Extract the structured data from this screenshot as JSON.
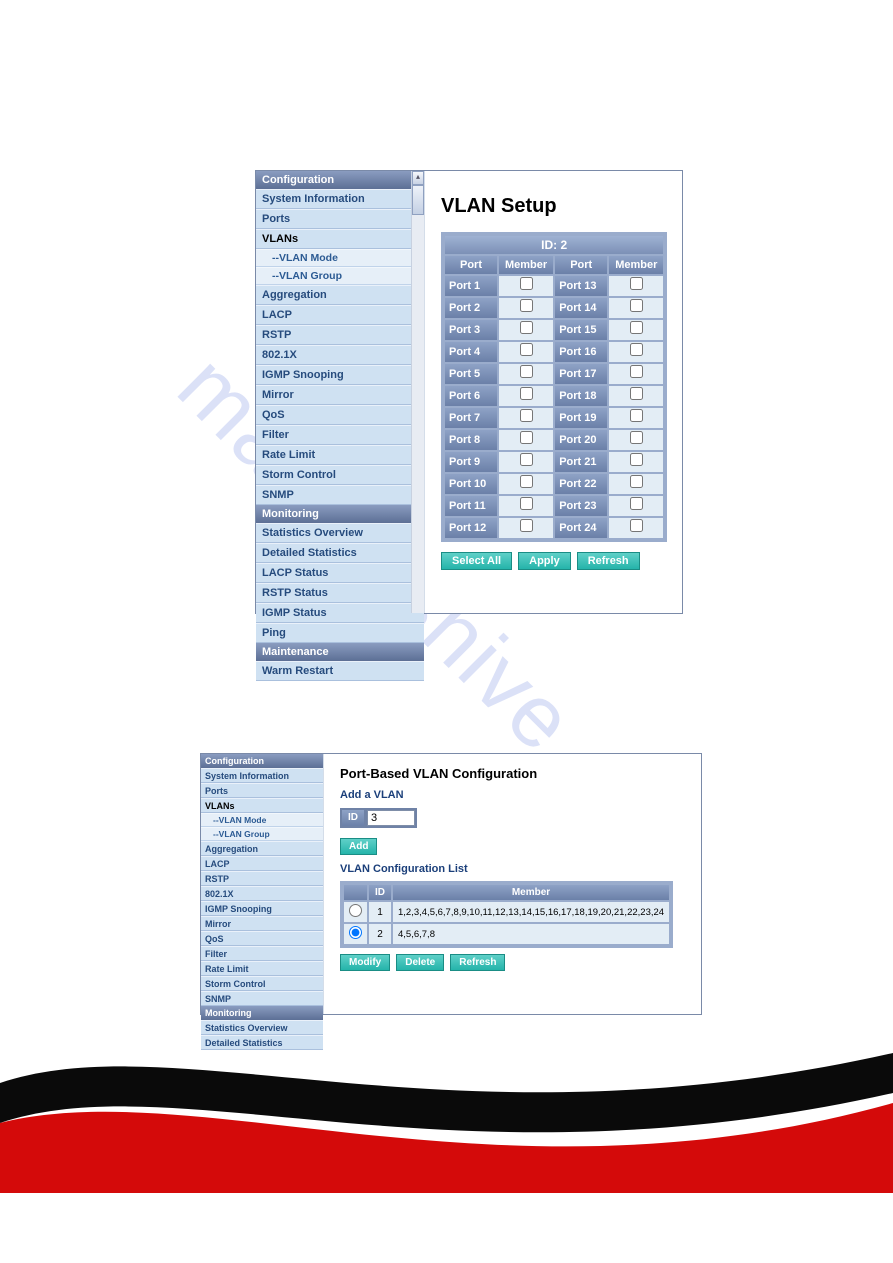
{
  "watermark_text": "manualshive.com",
  "nav1": {
    "section_config": "Configuration",
    "items_config": [
      "System Information",
      "Ports",
      "VLANs"
    ],
    "subitems": [
      "--VLAN Mode",
      "--VLAN Group"
    ],
    "items_config2": [
      "Aggregation",
      "LACP",
      "RSTP",
      "802.1X",
      "IGMP Snooping",
      "Mirror",
      "QoS",
      "Filter",
      "Rate Limit",
      "Storm Control",
      "SNMP"
    ],
    "section_monitoring": "Monitoring",
    "items_monitoring": [
      "Statistics Overview",
      "Detailed Statistics",
      "LACP Status",
      "RSTP Status",
      "IGMP Status",
      "Ping"
    ],
    "section_maintenance": "Maintenance",
    "items_maintenance": [
      "Warm Restart"
    ]
  },
  "vlan_setup": {
    "title": "VLAN Setup",
    "id_label": "ID: 2",
    "col_port": "Port",
    "col_member": "Member",
    "left_ports": [
      "Port 1",
      "Port 2",
      "Port 3",
      "Port 4",
      "Port 5",
      "Port 6",
      "Port 7",
      "Port 8",
      "Port 9",
      "Port 10",
      "Port 11",
      "Port 12"
    ],
    "right_ports": [
      "Port 13",
      "Port 14",
      "Port 15",
      "Port 16",
      "Port 17",
      "Port 18",
      "Port 19",
      "Port 20",
      "Port 21",
      "Port 22",
      "Port 23",
      "Port 24"
    ],
    "btn_select_all": "Select All",
    "btn_apply": "Apply",
    "btn_refresh": "Refresh"
  },
  "nav2": {
    "section_config": "Configuration",
    "items_config": [
      "System Information",
      "Ports",
      "VLANs"
    ],
    "subitems": [
      "--VLAN Mode",
      "--VLAN Group"
    ],
    "items_config2": [
      "Aggregation",
      "LACP",
      "RSTP",
      "802.1X",
      "IGMP Snooping",
      "Mirror",
      "QoS",
      "Filter",
      "Rate Limit",
      "Storm Control",
      "SNMP"
    ],
    "section_monitoring": "Monitoring",
    "items_monitoring": [
      "Statistics Overview",
      "Detailed Statistics"
    ]
  },
  "pb_vlan": {
    "title": "Port-Based VLAN Configuration",
    "add_label": "Add a VLAN",
    "id_label": "ID",
    "id_value": "3",
    "btn_add": "Add",
    "list_label": "VLAN Configuration List",
    "col_sel": "",
    "col_id": "ID",
    "col_member": "Member",
    "rows": [
      {
        "selected": false,
        "id": "1",
        "member": "1,2,3,4,5,6,7,8,9,10,11,12,13,14,15,16,17,18,19,20,21,22,23,24"
      },
      {
        "selected": true,
        "id": "2",
        "member": "4,5,6,7,8"
      }
    ],
    "btn_modify": "Modify",
    "btn_delete": "Delete",
    "btn_refresh": "Refresh"
  }
}
